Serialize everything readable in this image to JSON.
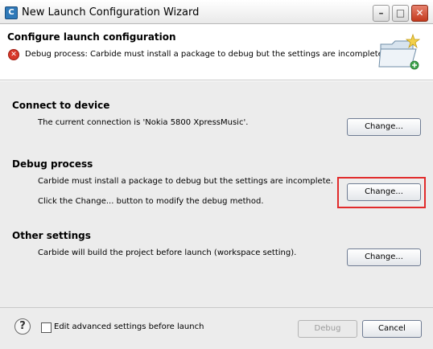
{
  "window": {
    "title": "New Launch Configuration Wizard",
    "icon_letter": "C",
    "minimize_icon": "minimize-icon",
    "maximize_icon": "maximize-icon",
    "close_icon": "close-icon"
  },
  "banner": {
    "title": "Configure launch configuration",
    "error_message": "Debug process: Carbide must install a package to debug but the settings are incomplete.",
    "error_icon": "error-icon",
    "image_icon": "folder-wizard-icon"
  },
  "sections": {
    "connect": {
      "title": "Connect to device",
      "description": "The current connection is 'Nokia 5800 XpressMusic'.",
      "button_label": "Change..."
    },
    "debug": {
      "title": "Debug process",
      "description": "Carbide must install a package to debug but the settings are incomplete.",
      "hint": "Click the Change... button to modify the debug method.",
      "button_label": "Change..."
    },
    "other": {
      "title": "Other settings",
      "description": "Carbide will build the project before launch (workspace setting).",
      "button_label": "Change..."
    }
  },
  "footer": {
    "help_icon": "help-icon",
    "checkbox_label": "Edit advanced settings before launch",
    "checkbox_checked": false,
    "debug_label": "Debug",
    "debug_enabled": false,
    "cancel_label": "Cancel"
  },
  "colors": {
    "highlight": "#e12b2b",
    "error": "#d8382a",
    "content_bg": "#ececec"
  }
}
